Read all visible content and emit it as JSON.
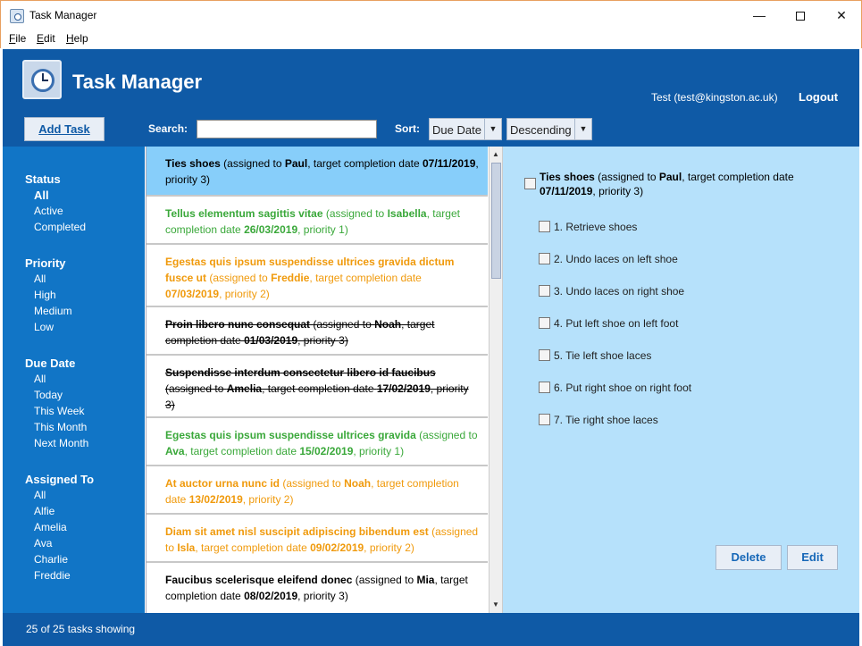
{
  "window": {
    "title": "Task Manager",
    "controls": {
      "minimize": "—",
      "close": "✕"
    }
  },
  "menu": [
    "File",
    "Edit",
    "Help"
  ],
  "header": {
    "app_title": "Task Manager",
    "user": "Test (test@kingston.ac.uk)",
    "logout": "Logout",
    "add_task": "Add Task",
    "search_label": "Search:",
    "search_value": "",
    "sort_label": "Sort:",
    "sort_field": "Due Date",
    "sort_order": "Descending",
    "accent_color": "#0f5aa6"
  },
  "filters": {
    "status": {
      "heading": "Status",
      "options": [
        "All",
        "Active",
        "Completed"
      ],
      "selected": "All"
    },
    "priority": {
      "heading": "Priority",
      "options": [
        "All",
        "High",
        "Medium",
        "Low"
      ]
    },
    "due_date": {
      "heading": "Due Date",
      "options": [
        "All",
        "Today",
        "This Week",
        "This Month",
        "Next Month"
      ]
    },
    "assigned_to": {
      "heading": "Assigned To",
      "options": [
        "All",
        "Alfie",
        "Amelia",
        "Ava",
        "Charlie",
        "Freddie"
      ]
    }
  },
  "tasks": [
    {
      "title": "Ties shoes",
      "assignee": "Paul",
      "date": "07/11/2019",
      "priority": "3",
      "state": "selected"
    },
    {
      "title": "Tellus elementum sagittis vitae",
      "assignee": "Isabella",
      "date": "26/03/2019",
      "priority": "1",
      "state": "green"
    },
    {
      "title": "Egestas quis ipsum suspendisse ultrices gravida dictum fusce ut",
      "assignee": "Freddie",
      "date": "07/03/2019",
      "priority": "2",
      "state": "orange"
    },
    {
      "title": "Proin libero nunc consequat",
      "assignee": "Noah",
      "date": "01/03/2019",
      "priority": "3",
      "state": "done"
    },
    {
      "title": "Suspendisse interdum consectetur libero id faucibus",
      "assignee": "Amelia",
      "date": "17/02/2019",
      "priority": "3",
      "state": "done"
    },
    {
      "title": "Egestas quis ipsum suspendisse ultrices gravida",
      "assignee": "Ava",
      "date": "15/02/2019",
      "priority": "1",
      "state": "green"
    },
    {
      "title": "At auctor urna nunc id",
      "assignee": "Noah",
      "date": "13/02/2019",
      "priority": "2",
      "state": "orange"
    },
    {
      "title": "Diam sit amet nisl suscipit adipiscing bibendum est",
      "assignee": "Isla",
      "date": "09/02/2019",
      "priority": "2",
      "state": "orange"
    },
    {
      "title": "Faucibus scelerisque eleifend donec",
      "assignee": "Mia",
      "date": "08/02/2019",
      "priority": "3",
      "state": "normal"
    }
  ],
  "task_text": {
    "assigned_prefix": "(assigned to ",
    "target_text": ", target completion date ",
    "priority_text": ", priority ",
    "suffix": ")"
  },
  "detail": {
    "title": "Ties shoes",
    "assignee": "Paul",
    "date": "07/11/2019",
    "priority": "3",
    "subtasks": [
      "1. Retrieve shoes",
      "2. Undo laces on left shoe",
      "3. Undo laces on right shoe",
      "4. Put left shoe on left foot",
      "5. Tie left shoe laces",
      "6. Put right shoe on right foot",
      "7. Tie right shoe laces"
    ],
    "delete": "Delete",
    "edit": "Edit"
  },
  "status_bar": {
    "text": "25 of 25 tasks showing"
  }
}
